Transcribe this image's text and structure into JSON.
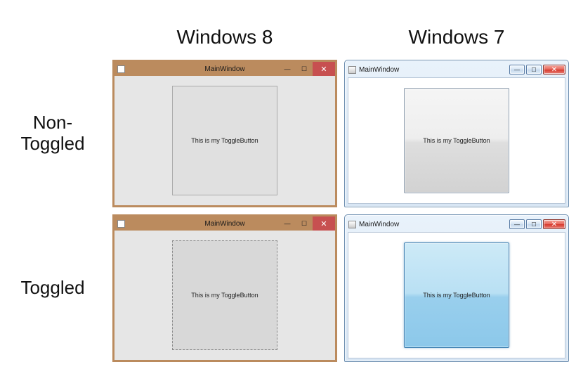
{
  "headers": {
    "col_win8": "Windows 8",
    "col_win7": "Windows 7",
    "row_nontoggled": "Non-\nToggled",
    "row_toggled": "Toggled"
  },
  "window": {
    "title": "MainWindow",
    "toggle_label": "This is my ToggleButton",
    "controls": {
      "minimize_glyph": "—",
      "maximize_glyph": "☐",
      "close_glyph": "✕"
    }
  },
  "colors": {
    "win8_chrome": "#bb8b5e",
    "win8_close": "#c75050",
    "win7_aero_border": "#6c8eb0",
    "win7_close": "#d7392c",
    "win7_pressed_accent": "#99cfed"
  }
}
